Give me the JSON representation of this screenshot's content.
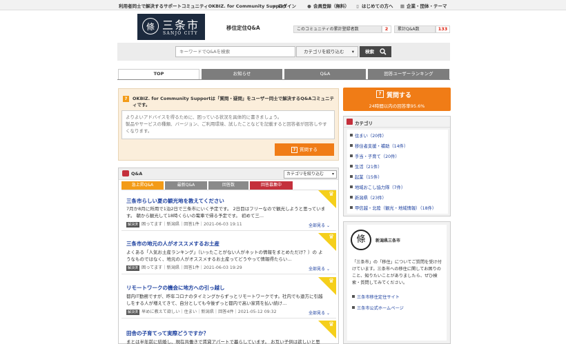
{
  "topbar": {
    "tagline": "利用者同士で解決するサポートコミュニティOKBIZ. for Community Support",
    "login": "ログイン",
    "register": "会員登録（無料）",
    "first_time": "はじめての方へ",
    "corporate": "企業・団体・テーマ"
  },
  "header": {
    "logo_kanji": "三条市",
    "logo_en": "SANJO CITY",
    "logo_emblem": "條",
    "community_name": "移住定住Q&A",
    "stat_users_label": "このコミュニティの累計登録者数",
    "stat_users_value": "2",
    "stat_qa_label": "累計Q&A数",
    "stat_qa_value": "133"
  },
  "search": {
    "placeholder": "キーワードでQ&Aを検索",
    "category_label": "カテゴリを絞り込む",
    "button": "検索"
  },
  "nav": {
    "tabs": [
      "TOP",
      "お知らせ",
      "Q&A",
      "回答ユーザーランキング"
    ],
    "active": "TOP"
  },
  "post": {
    "intro": "OKBIZ. for Community Supportは「質問・疑問」をユーザー同士で解決するQ&Aコミュニティです。",
    "placeholder": "よりよいアドバイスを得るために、困っている状況を具体的に書きましょう。\n製品やサービスの種類、バージョン、ご利用環境、試したことなどを記載すると回答者が回答しやすくなります。",
    "button": "質問する"
  },
  "qa": {
    "title": "Q&A",
    "filter": "カテゴリを絞り込む",
    "subtabs": [
      "急上昇Q&A",
      "最新Q&A",
      "回答数",
      "回答募集中"
    ],
    "show_all": "全部見る",
    "items": [
      {
        "title": "三条市らしい夏の観光地を教えてください",
        "body": "7月か8月に所用で1泊2日で三条市にいく予定です。 2日目はフリーなので観光しようと思っています。 朝から観光して18時くらいの電車で帰る予定です。 初めて三...",
        "status": "解決済",
        "meta": "困ってます｜新潟県｜回答1件｜2021-06-03 19:11"
      },
      {
        "title": "三条市の地元の人がオススメするお土産",
        "body": "よくある「人気お土産ランキング」（いったことがない人がネットの情報をまとめただけ？）の ようなものではなく、地元の人がオススメするお土産ってどうやって情報得たらい...",
        "status": "解決済",
        "meta": "困ってます｜新潟県｜回答1件｜2021-06-03 19:29"
      },
      {
        "title": "リモートワークの機会に地方への引っ越し",
        "body": "都内IT勤務ですが、昨年コロナのタイミングからずっとリモートワークです。社内でも遠方に引越しをする人が増えてきて、自分としても今後ずっと都内で高い家賃を払い続け...",
        "status": "解決済",
        "meta": "早めに教えて欲しい｜住まい｜新潟県｜回答4件｜2021-05-12 09:32"
      },
      {
        "title": "田舎の子育てって実際どうですか？",
        "body": "まとは半年前に結婚し、現在共働きで賃貸アパートで暮らしています。 お互い子供は欲しいと思",
        "status": "",
        "meta": ""
      }
    ]
  },
  "right": {
    "ask_title": "質問する",
    "ask_sub": "24時間以内の回答率95.6%",
    "category_title": "カテゴリ",
    "categories": [
      "住まい（20件）",
      "移住者支援・補助（14件）",
      "手当・子育て（20件）",
      "生活（21件）",
      "起業（15件）",
      "地域おこし協力隊（7件）",
      "新潟県（23件）",
      "甲信越・北陸（観光・地域情報）（18件）"
    ],
    "org_name": "新潟県三条市",
    "org_desc": "「三条市」の「移住」についてご質問を受け付けています。三条市への移住に関してお困りのこと、知りたいことがありましたら、ぜひ検索・質問してみてください。",
    "links": [
      "三条市移住定住サイト",
      "三条市公式ホームページ"
    ]
  },
  "colors": {
    "accent_orange": "#f07c16",
    "link_blue": "#1a3e9e",
    "logo_navy": "#1c2a3e",
    "rising_tab": "#f39b17",
    "open_tab": "#c4303c",
    "corner_yellow": "#f5cf1b"
  }
}
